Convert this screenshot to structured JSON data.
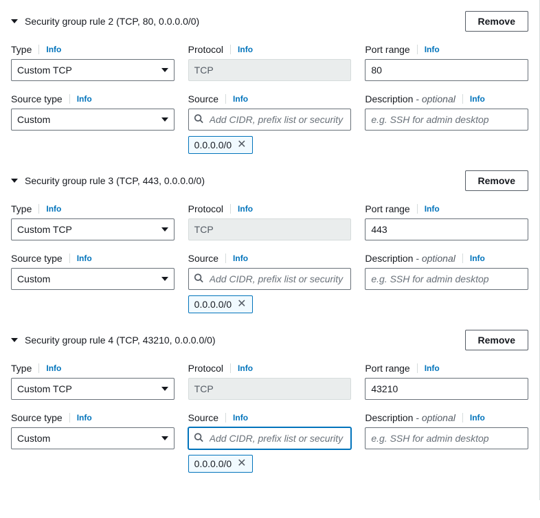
{
  "labels": {
    "info": "Info",
    "remove": "Remove",
    "type": "Type",
    "protocol": "Protocol",
    "port_range": "Port range",
    "source_type": "Source type",
    "source": "Source",
    "description": "Description",
    "optional": "- optional",
    "source_placeholder": "Add CIDR, prefix list or security",
    "description_placeholder": "e.g. SSH for admin desktop"
  },
  "rules": [
    {
      "index": 2,
      "title": "Security group rule 2 (TCP, 80, 0.0.0.0/0)",
      "type": "Custom TCP",
      "protocol": "TCP",
      "port_range": "80",
      "source_type": "Custom",
      "source_token": "0.0.0.0/0",
      "source_focused": false,
      "description": ""
    },
    {
      "index": 3,
      "title": "Security group rule 3 (TCP, 443, 0.0.0.0/0)",
      "type": "Custom TCP",
      "protocol": "TCP",
      "port_range": "443",
      "source_type": "Custom",
      "source_token": "0.0.0.0/0",
      "source_focused": false,
      "description": ""
    },
    {
      "index": 4,
      "title": "Security group rule 4 (TCP, 43210, 0.0.0.0/0)",
      "type": "Custom TCP",
      "protocol": "TCP",
      "port_range": "43210",
      "source_type": "Custom",
      "source_token": "0.0.0.0/0",
      "source_focused": true,
      "description": ""
    }
  ]
}
